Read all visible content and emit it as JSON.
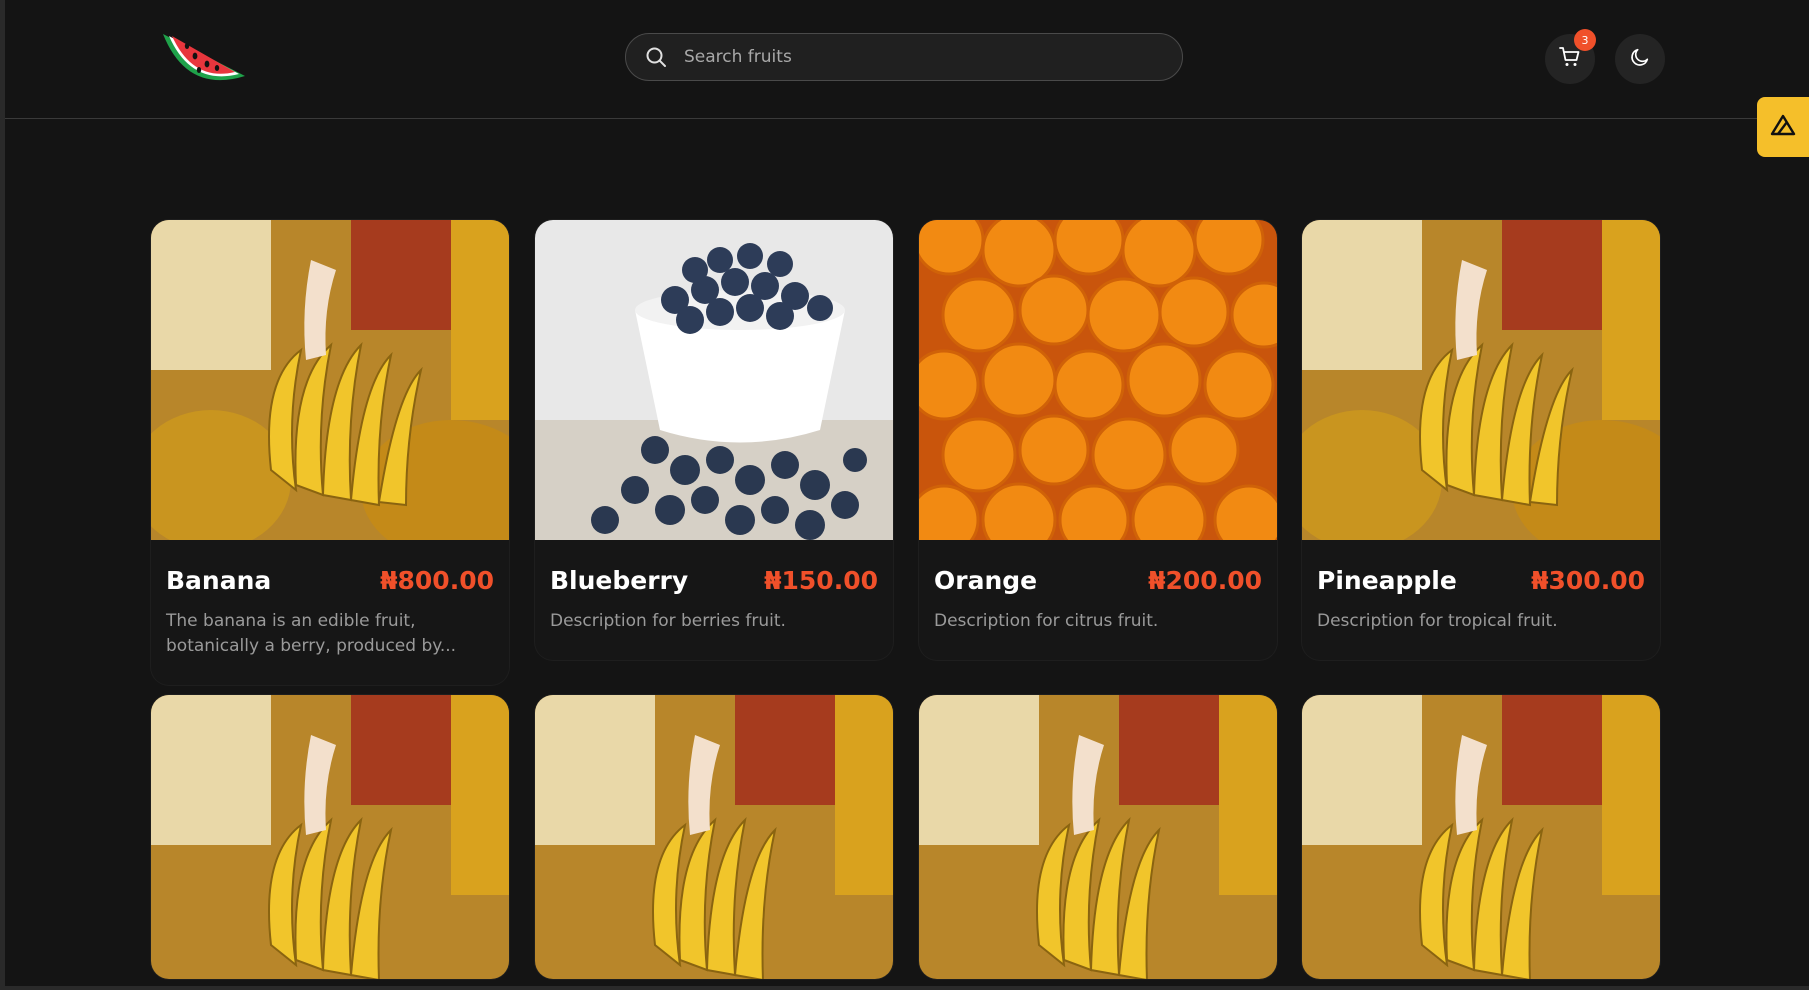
{
  "header": {
    "logo_icon": "watermelon-icon",
    "search": {
      "placeholder": "Search fruits",
      "value": ""
    },
    "cart": {
      "icon": "cart-icon",
      "count": "3"
    },
    "theme_toggle": {
      "icon": "moon-icon"
    },
    "side_tab_icon": "triangle-logo-icon"
  },
  "colors": {
    "background": "#141414",
    "accent": "#f0502a",
    "side_tab": "#f5bf2a"
  },
  "products": [
    {
      "name": "Banana",
      "price": "₦800.00",
      "description": "The banana is an edible fruit, botanically a berry, produced by...",
      "image": "banana"
    },
    {
      "name": "Blueberry",
      "price": "₦150.00",
      "description": "Description for berries fruit.",
      "image": "blueberry"
    },
    {
      "name": "Orange",
      "price": "₦200.00",
      "description": "Description for citrus fruit.",
      "image": "orange"
    },
    {
      "name": "Pineapple",
      "price": "₦300.00",
      "description": "Description for tropical fruit.",
      "image": "banana"
    },
    {
      "image": "banana"
    },
    {
      "image": "banana"
    },
    {
      "image": "banana"
    },
    {
      "image": "banana"
    }
  ]
}
